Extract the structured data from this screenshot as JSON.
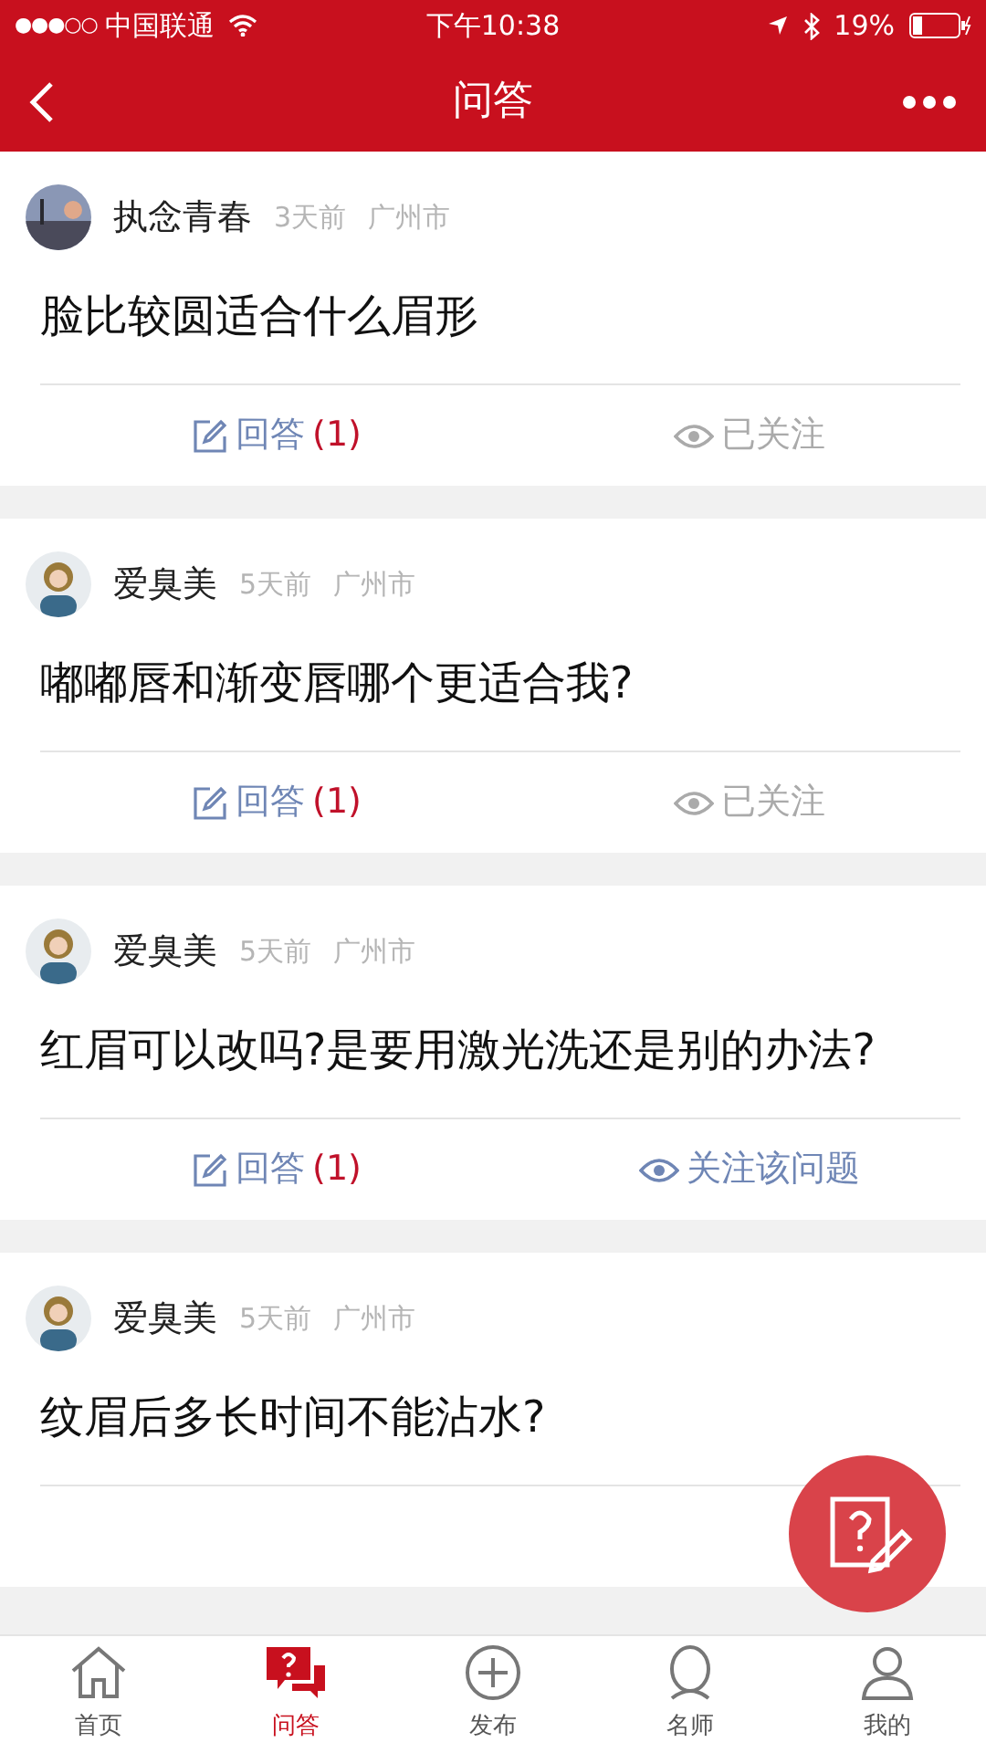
{
  "status_bar": {
    "signal": "●●●○○",
    "carrier": "中国联通",
    "time": "下午10:38",
    "battery": "19%"
  },
  "nav": {
    "title": "问答"
  },
  "questions": [
    {
      "author": "执念青春",
      "time": "3天前",
      "city": "广州市",
      "title": "脸比较圆适合什么眉形",
      "answer_label": "回答",
      "answer_count": "(1)",
      "followed": true,
      "follow_label": "已关注"
    },
    {
      "author": "爱臭美",
      "time": "5天前",
      "city": "广州市",
      "title": "嘟嘟唇和渐变唇哪个更适合我?",
      "answer_label": "回答",
      "answer_count": "(1)",
      "followed": true,
      "follow_label": "已关注"
    },
    {
      "author": "爱臭美",
      "time": "5天前",
      "city": "广州市",
      "title": "红眉可以改吗?是要用激光洗还是别的办法?",
      "answer_label": "回答",
      "answer_count": "(1)",
      "followed": false,
      "follow_label": "关注该问题"
    },
    {
      "author": "爱臭美",
      "time": "5天前",
      "city": "广州市",
      "title": "纹眉后多长时间不能沾水?"
    }
  ],
  "tabs": [
    {
      "kind": "home",
      "label": "首页",
      "selected": false
    },
    {
      "kind": "qa",
      "label": "问答",
      "selected": true
    },
    {
      "kind": "publish",
      "label": "发布",
      "selected": false
    },
    {
      "kind": "teacher",
      "label": "名师",
      "selected": false
    },
    {
      "kind": "me",
      "label": "我的",
      "selected": false
    }
  ]
}
